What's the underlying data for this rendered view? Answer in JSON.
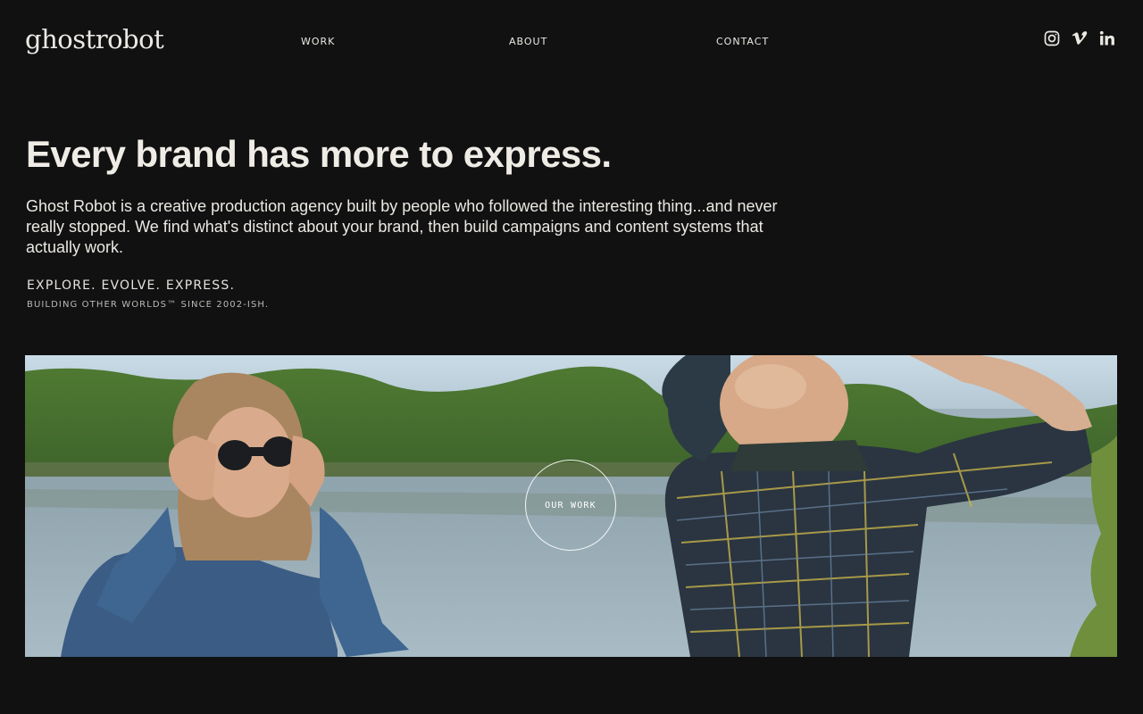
{
  "header": {
    "logo_text": "ghostrobot",
    "nav": [
      {
        "label": "WORK"
      },
      {
        "label": "ABOUT"
      },
      {
        "label": "CONTACT"
      }
    ],
    "social_icons": [
      "instagram-icon",
      "vimeo-icon",
      "linkedin-icon"
    ]
  },
  "hero_text": {
    "headline": "Every brand has more to express.",
    "intro": "Ghost Robot is a creative production agency built by people who followed the interesting thing...and never really stopped. We find what's distinct about your brand, then build campaigns and content systems that actually work.",
    "tagline": "EXPLORE. EVOLVE. EXPRESS.",
    "subtagline": "BUILDING OTHER WORLDS™ SINCE 2002-ISH."
  },
  "hero_media": {
    "cta_label": "OUR WORK",
    "image_description_icon": "video-still"
  },
  "colors": {
    "background": "#111112",
    "text": "#ece9e3"
  }
}
